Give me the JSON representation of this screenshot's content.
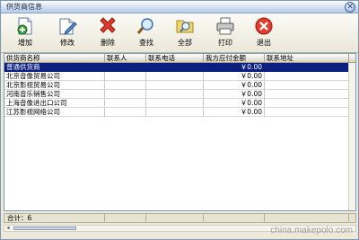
{
  "window": {
    "title": "供货商信息",
    "close_glyph": "✕"
  },
  "toolbar": {
    "buttons": [
      {
        "label": "增加",
        "icon": "add-document-icon"
      },
      {
        "label": "修改",
        "icon": "edit-document-icon"
      },
      {
        "label": "删除",
        "icon": "delete-x-icon"
      },
      {
        "label": "查找",
        "icon": "magnifier-icon"
      },
      {
        "label": "全部",
        "icon": "search-all-icon"
      },
      {
        "label": "打印",
        "icon": "printer-icon"
      },
      {
        "label": "退出",
        "icon": "exit-icon"
      }
    ]
  },
  "table": {
    "columns": [
      "供货商名称",
      "联系人",
      "联系电话",
      "我方应付金额",
      "联系地址",
      ""
    ],
    "rows": [
      {
        "name": "普通供货商",
        "contact": "",
        "phone": "",
        "amount": "￥0.00",
        "address": ""
      },
      {
        "name": "北京音像贸易公司",
        "contact": "",
        "phone": "",
        "amount": "￥0.00",
        "address": ""
      },
      {
        "name": "北京影视贸易公司",
        "contact": "",
        "phone": "",
        "amount": "￥0.00",
        "address": ""
      },
      {
        "name": "河南音乐销售公司",
        "contact": "",
        "phone": "",
        "amount": "￥0.00",
        "address": ""
      },
      {
        "name": "上海音像进出口公司",
        "contact": "",
        "phone": "",
        "amount": "￥0.00",
        "address": ""
      },
      {
        "name": "江苏影视网络公司",
        "contact": "",
        "phone": "",
        "amount": "￥0.00",
        "address": ""
      }
    ],
    "selected_row": 0
  },
  "status": {
    "total_label": "合计：6"
  },
  "watermark": "china.makepolo.com",
  "colors": {
    "selection": "#0a1f7e",
    "titlebar": "#cfdcf0"
  }
}
